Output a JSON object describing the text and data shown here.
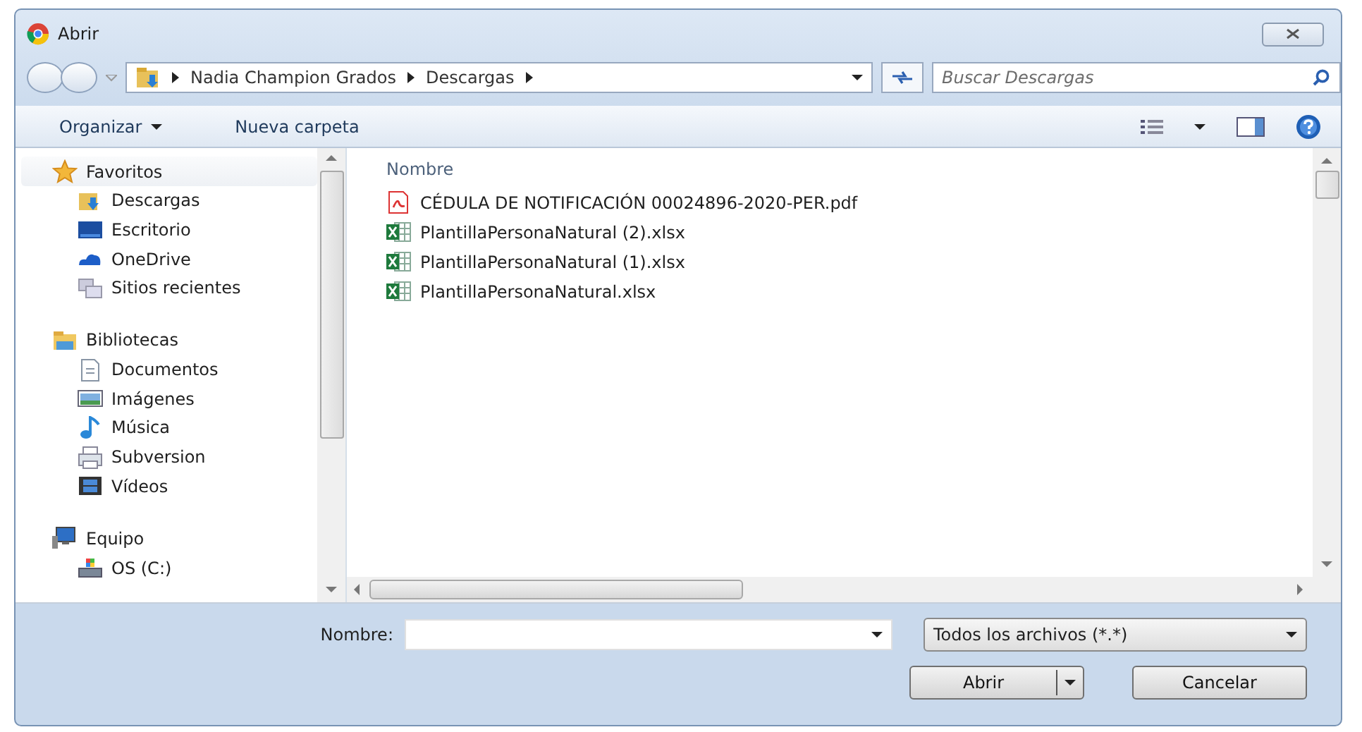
{
  "window": {
    "title": "Abrir"
  },
  "address_bar": {
    "path": [
      "Nadia Champion Grados",
      "Descargas"
    ]
  },
  "search": {
    "placeholder": "Buscar Descargas"
  },
  "toolbar": {
    "organize": "Organizar",
    "new_folder": "Nueva carpeta"
  },
  "sidebar": {
    "groups": [
      {
        "label": "Favoritos",
        "selected": true,
        "children": [
          {
            "label": "Descargas"
          },
          {
            "label": "Escritorio"
          },
          {
            "label": "OneDrive"
          },
          {
            "label": "Sitios recientes"
          }
        ]
      },
      {
        "label": "Bibliotecas",
        "selected": false,
        "children": [
          {
            "label": "Documentos"
          },
          {
            "label": "Imágenes"
          },
          {
            "label": "Música"
          },
          {
            "label": "Subversion"
          },
          {
            "label": "Vídeos"
          }
        ]
      },
      {
        "label": "Equipo",
        "selected": false,
        "children": [
          {
            "label": "OS (C:)"
          }
        ]
      }
    ]
  },
  "file_list": {
    "column": "Nombre",
    "files": [
      {
        "name": "CÉDULA DE NOTIFICACIÓN 00024896-2020-PER.pdf",
        "kind": "pdf"
      },
      {
        "name": "PlantillaPersonaNatural (2).xlsx",
        "kind": "xlsx"
      },
      {
        "name": "PlantillaPersonaNatural (1).xlsx",
        "kind": "xlsx"
      },
      {
        "name": "PlantillaPersonaNatural.xlsx",
        "kind": "xlsx"
      }
    ]
  },
  "footer": {
    "filename_label": "Nombre:",
    "file_type": "Todos los archivos (*.*)",
    "buttons": [
      {
        "label": "Abrir",
        "kind": "split"
      },
      {
        "label": "Cancelar",
        "kind": "plain"
      }
    ]
  }
}
